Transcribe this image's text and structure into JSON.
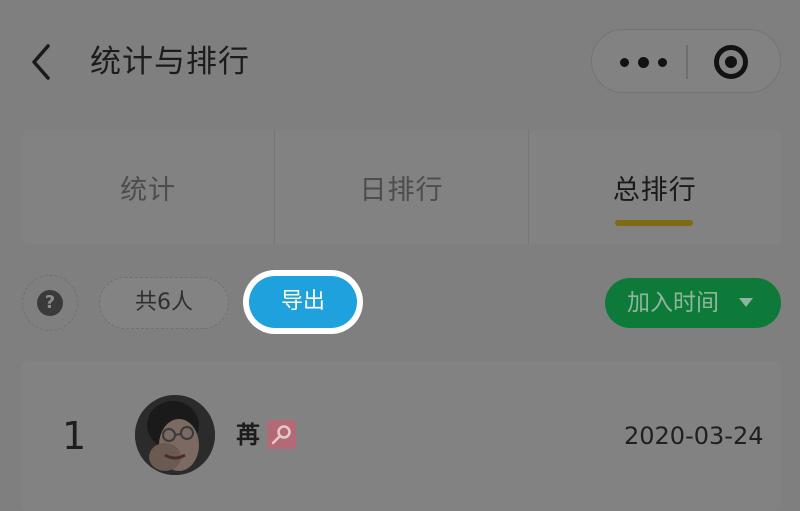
{
  "header": {
    "back_icon": "chevron-left-icon",
    "title": "统计与排行",
    "more_icon": "more-dots-icon",
    "target_icon": "target-icon"
  },
  "tabs": [
    {
      "label": "统计",
      "active": false
    },
    {
      "label": "日排行",
      "active": false
    },
    {
      "label": "总排行",
      "active": true
    }
  ],
  "controls": {
    "help_icon": "question-icon",
    "help_label": "?",
    "count_label": "共6人",
    "export_label": "导出",
    "sort_label": "加入时间",
    "sort_caret_icon": "caret-down-icon"
  },
  "ranking": [
    {
      "rank": "1",
      "name": "苒",
      "badge_icon": "key-icon",
      "date": "2020-03-24"
    }
  ],
  "colors": {
    "overlay_bg": "#7f7f7f",
    "export_blue": "#1ea1dc",
    "sort_green": "#0e7a3a",
    "tab_indicator": "#7e6b12",
    "badge": "#b36a77"
  }
}
